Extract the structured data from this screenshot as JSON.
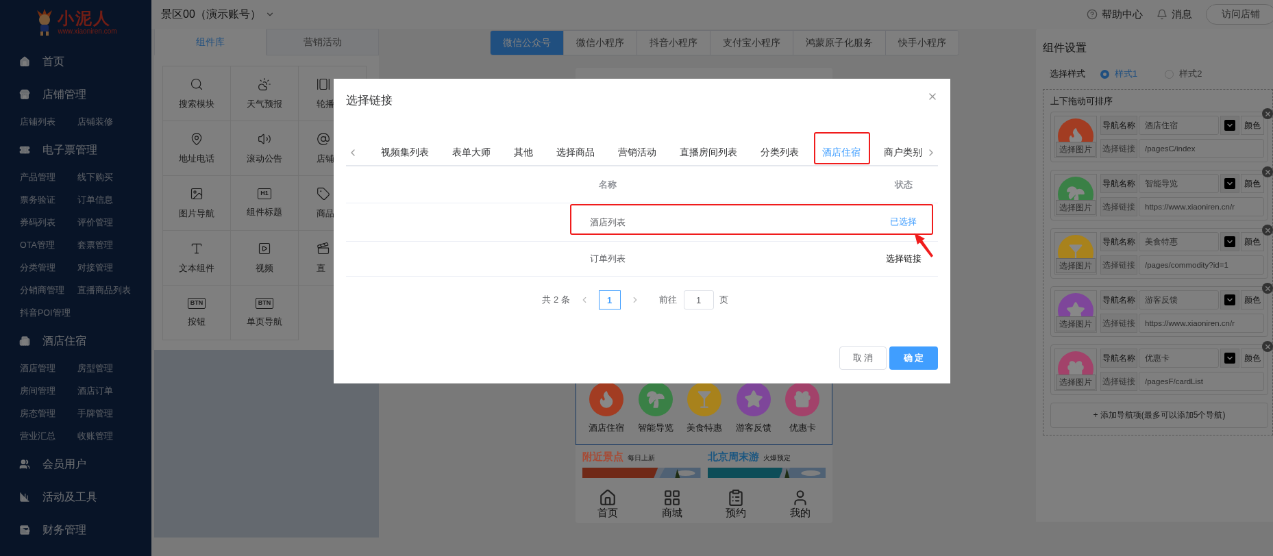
{
  "header": {
    "account": "景区00（演示账号）",
    "links": [
      "帮助中心",
      "消息"
    ],
    "visit_button": "访问店铺"
  },
  "sidebar": {
    "logo": {
      "title": "小泥人",
      "url": "www.xiaoniren.com"
    },
    "sections": [
      {
        "label": "首页"
      },
      {
        "label": "店铺管理",
        "children": [
          "店铺列表",
          "店铺装修"
        ]
      },
      {
        "label": "电子票管理",
        "children": [
          "产品管理",
          "线下购买",
          "票务验证",
          "订单信息",
          "券码列表",
          "评价管理",
          "OTA管理",
          "套票管理",
          "分类管理",
          "对接管理",
          "分销商管理",
          "直播商品列表",
          "抖音POI管理"
        ]
      },
      {
        "label": "酒店住宿",
        "children": [
          "酒店管理",
          "房型管理",
          "房间管理",
          "酒店订单",
          "房态管理",
          "手牌管理",
          "营业汇总",
          "收账管理"
        ]
      },
      {
        "label": "会员用户"
      },
      {
        "label": "活动及工具"
      },
      {
        "label": "财务管理"
      }
    ]
  },
  "components_panel": {
    "tabs": [
      {
        "label": "组件库",
        "selected": true
      },
      {
        "label": "营销活动",
        "selected": false
      }
    ],
    "items": [
      {
        "label": "搜索模块"
      },
      {
        "label": "天气预报"
      },
      {
        "label": "轮播"
      },
      {
        "label": "地址电话"
      },
      {
        "label": "滚动公告"
      },
      {
        "label": "店铺"
      },
      {
        "label": "图片导航"
      },
      {
        "label": "组件标题",
        "icon_text": "H1"
      },
      {
        "label": "商品"
      },
      {
        "label": "文本组件"
      },
      {
        "label": "视频"
      },
      {
        "label": "直"
      },
      {
        "label": "按钮",
        "icon_text": "BTN"
      },
      {
        "label": "单页导航",
        "icon_text": "BTN"
      }
    ]
  },
  "platform_tabs": [
    {
      "label": "微信公众号",
      "selected": true
    },
    {
      "label": "微信小程序",
      "selected": false
    },
    {
      "label": "抖音小程序",
      "selected": false
    },
    {
      "label": "支付宝小程序",
      "selected": false
    },
    {
      "label": "鸿蒙原子化服务",
      "selected": false
    },
    {
      "label": "快手小程序",
      "selected": false
    }
  ],
  "phone": {
    "nav_items": [
      {
        "label": "酒店住宿",
        "color": "#a23c22"
      },
      {
        "label": "智能导览",
        "color": "#3a8046"
      },
      {
        "label": "美食特惠",
        "color": "#a8821c"
      },
      {
        "label": "游客反馈",
        "color": "#7e469a"
      },
      {
        "label": "优惠卡",
        "color": "#a2426a"
      }
    ],
    "sections": [
      {
        "title": "附近景点",
        "subtitle": "每日上新",
        "color": "#a84a34"
      },
      {
        "title": "北京周末游",
        "subtitle": "火爆预定",
        "color": "#1b5680"
      }
    ],
    "tab_bar": [
      "首页",
      "商城",
      "预约",
      "我的"
    ]
  },
  "settings": {
    "title": "组件设置",
    "style_label": "选择样式",
    "styles": [
      {
        "label": "样式1",
        "selected": true
      },
      {
        "label": "样式2",
        "selected": false
      }
    ],
    "sort_hint": "上下拖动可排序",
    "items": [
      {
        "image_button": "选择图片",
        "name_label": "导航名称",
        "name": "酒店住宿",
        "color_label": "颜色",
        "link_label": "选择链接",
        "link": "/pagesC/index",
        "color": "#a23c22"
      },
      {
        "image_button": "选择图片",
        "name_label": "导航名称",
        "name": "智能导览",
        "color_label": "颜色",
        "link_label": "选择链接",
        "link": "https://www.xiaoniren.cn/r",
        "color": "#3a8046"
      },
      {
        "image_button": "选择图片",
        "name_label": "导航名称",
        "name": "美食特惠",
        "color_label": "颜色",
        "link_label": "选择链接",
        "link": "/pages/commodity?id=1",
        "color": "#a8821c"
      },
      {
        "image_button": "选择图片",
        "name_label": "导航名称",
        "name": "游客反馈",
        "color_label": "颜色",
        "link_label": "选择链接",
        "link": "https://www.xiaoniren.cn/r",
        "color": "#7e469a"
      },
      {
        "image_button": "选择图片",
        "name_label": "导航名称",
        "name": "优惠卡",
        "color_label": "颜色",
        "link_label": "选择链接",
        "link": "/pagesF/cardList",
        "color": "#a2426a"
      }
    ],
    "add_button": "+ 添加导航项(最多可以添加5个导航)"
  },
  "dialog": {
    "title": "选择链接",
    "tabs": [
      {
        "label": "视频集列表",
        "selected": false
      },
      {
        "label": "表单大师",
        "selected": false
      },
      {
        "label": "其他",
        "selected": false
      },
      {
        "label": "选择商品",
        "selected": false
      },
      {
        "label": "营销活动",
        "selected": false
      },
      {
        "label": "直播房间列表",
        "selected": false
      },
      {
        "label": "分类列表",
        "selected": false
      },
      {
        "label": "酒店住宿",
        "selected": true
      },
      {
        "label": "商户类别",
        "selected": false
      }
    ],
    "columns": [
      "名称",
      "状态"
    ],
    "rows": [
      {
        "name": "酒店列表",
        "status": "已选择",
        "selected": true
      },
      {
        "name": "订单列表",
        "status": "选择链接",
        "selected": false
      }
    ],
    "pagination": {
      "total": "共 2 条",
      "pages": [
        {
          "label": "1",
          "selected": true
        }
      ],
      "goto_label": "前往",
      "goto_value": "1",
      "page_suffix": "页"
    },
    "buttons": {
      "cancel": "取 消",
      "confirm": "确 定"
    }
  }
}
